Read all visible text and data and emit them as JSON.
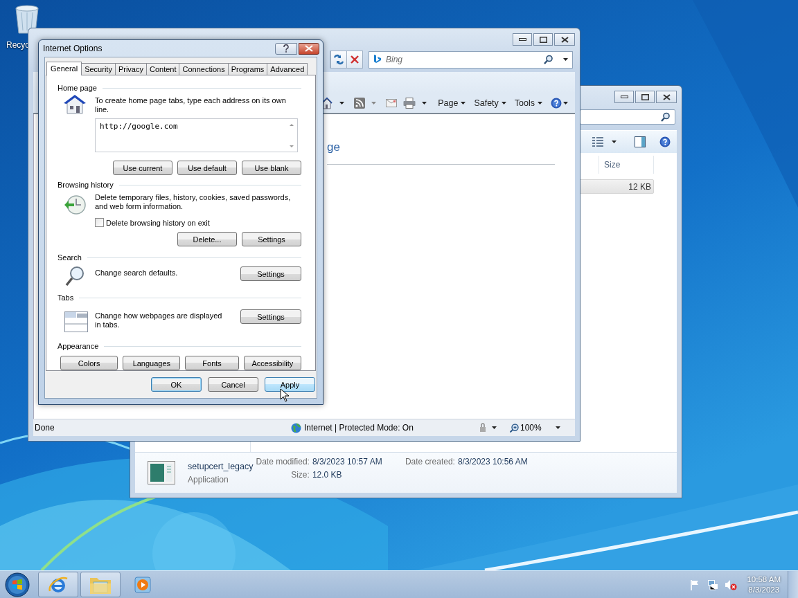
{
  "desktop": {
    "icons": [
      {
        "label": "Recyc"
      }
    ]
  },
  "explorer_window": {
    "columns": [
      {
        "label": "Size"
      }
    ],
    "rows": [
      {
        "size": "12 KB",
        "selected": true
      }
    ],
    "details": {
      "name": "setupcert_legacy",
      "type": "Application",
      "fields": [
        {
          "label": "Date modified:",
          "value": "8/3/2023 10:57 AM"
        },
        {
          "label": "Date created:",
          "value": "8/3/2023 10:56 AM"
        },
        {
          "label": "Size:",
          "value": "12.0 KB"
        }
      ]
    }
  },
  "browser_window": {
    "search": {
      "placeholder": "Bing"
    },
    "command_bar": [
      {
        "label": "Page"
      },
      {
        "label": "Safety"
      },
      {
        "label": "Tools"
      }
    ],
    "page": {
      "heading": "ge"
    },
    "status_bar": {
      "status": "Done",
      "zone": "Internet | Protected Mode: On",
      "zoom": "100%"
    }
  },
  "dialog": {
    "title": "Internet Options",
    "tabs": [
      {
        "label": "General",
        "selected": true
      },
      {
        "label": "Security",
        "selected": false
      },
      {
        "label": "Privacy",
        "selected": false
      },
      {
        "label": "Content",
        "selected": false
      },
      {
        "label": "Connections",
        "selected": false
      },
      {
        "label": "Programs",
        "selected": false
      },
      {
        "label": "Advanced",
        "selected": false
      }
    ],
    "sections": [
      {
        "kind": "home",
        "title": "Home page",
        "text": "To create home page tabs, type each address on its own line.",
        "addresses": "http://google.com",
        "buttons": [
          "Use current",
          "Use default",
          "Use blank"
        ]
      },
      {
        "kind": "history",
        "title": "Browsing history",
        "text": "Delete temporary files, history, cookies, saved passwords, and web form information.",
        "checkbox": {
          "label": "Delete browsing history on exit",
          "checked": false
        },
        "buttons": [
          "Delete...",
          "Settings"
        ]
      },
      {
        "kind": "search",
        "title": "Search",
        "text": "Change search defaults.",
        "buttons": [
          "Settings"
        ]
      },
      {
        "kind": "tabs",
        "title": "Tabs",
        "text": "Change how webpages are displayed in tabs.",
        "buttons": [
          "Settings"
        ]
      },
      {
        "kind": "appearance",
        "title": "Appearance",
        "buttons": [
          "Colors",
          "Languages",
          "Fonts",
          "Accessibility"
        ]
      }
    ],
    "buttons": [
      {
        "label": "OK",
        "default": true,
        "hovered": false
      },
      {
        "label": "Cancel",
        "default": false,
        "hovered": false
      },
      {
        "label": "Apply",
        "default": false,
        "hovered": true
      }
    ]
  },
  "taskbar": {
    "clock": {
      "time": "10:58 AM",
      "date": "8/3/2023"
    }
  }
}
